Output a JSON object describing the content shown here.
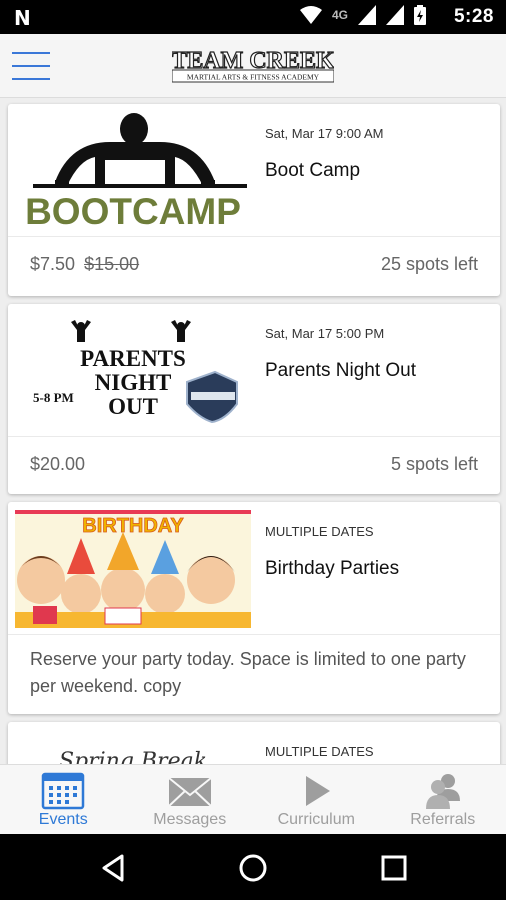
{
  "status_bar": {
    "time": "5:28",
    "network_label": "4G",
    "notification_icon": "n-icon"
  },
  "header": {
    "logo_text": "TEAM CREEK",
    "logo_subtext": "MARTIAL ARTS & FITNESS ACADEMY"
  },
  "events": [
    {
      "thumb_text": "BOOTCAMP",
      "date": "Sat, Mar 17 9:00 AM",
      "title": "Boot Camp",
      "price": "$7.50",
      "old_price": "$15.00",
      "spots": "25 spots left"
    },
    {
      "thumb_line1": "PARENTS",
      "thumb_line2": "NIGHT",
      "thumb_line3": "OUT",
      "thumb_time": "5-8 PM",
      "date": "Sat, Mar 17 5:00 PM",
      "title": "Parents Night Out",
      "price": "$20.00",
      "spots": "5 spots left"
    },
    {
      "thumb_text": "BIRTHDAY",
      "date": "MULTIPLE DATES",
      "title": "Birthday Parties",
      "description": "Reserve your party today. Space is limited to one party per weekend. copy"
    },
    {
      "thumb_text": "Spring Break",
      "date": "MULTIPLE DATES"
    }
  ],
  "bottom_nav": [
    {
      "label": "Events",
      "icon": "calendar-icon",
      "active": true
    },
    {
      "label": "Messages",
      "icon": "envelope-icon",
      "active": false
    },
    {
      "label": "Curriculum",
      "icon": "play-icon",
      "active": false
    },
    {
      "label": "Referrals",
      "icon": "people-icon",
      "active": false
    }
  ],
  "colors": {
    "accent": "#2e79d6",
    "inactive": "#9e9e9e",
    "bootcamp_green": "#6e7d3a"
  }
}
